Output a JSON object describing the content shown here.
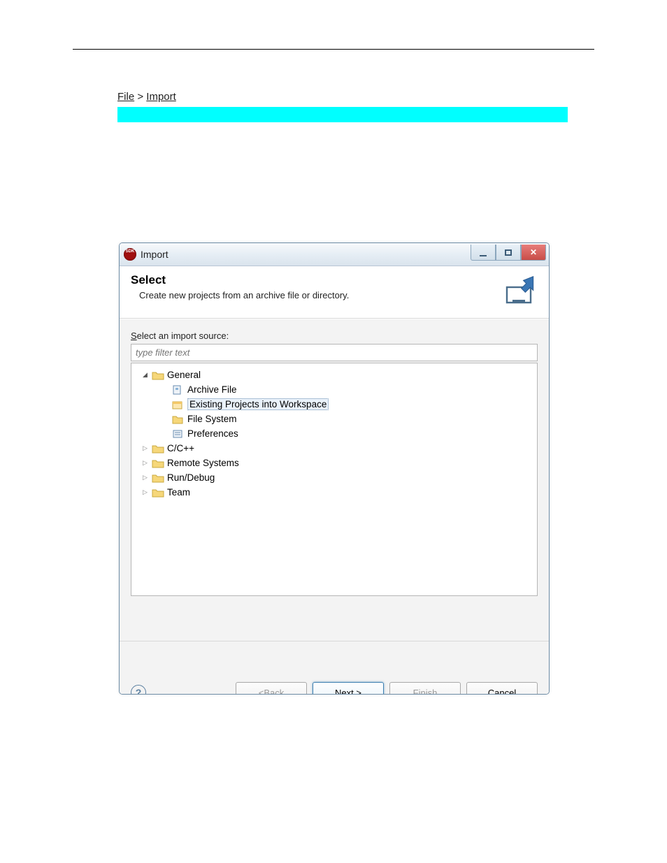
{
  "page": {
    "instr_prefix": "File",
    "instr_arrow": " > ",
    "instr_import": "Import"
  },
  "dialog": {
    "title": "Import",
    "header_title": "Select",
    "header_desc": "Create new projects from an archive file or directory.",
    "body_label_pre": "S",
    "body_label_post": "elect an import source:",
    "filter_placeholder": "type filter text",
    "tree": {
      "general": "General",
      "archive": "Archive File",
      "existing": "Existing Projects into Workspace",
      "filesystem": "File System",
      "preferences": "Preferences",
      "cpp": "C/C++",
      "remote": "Remote Systems",
      "rundebug": "Run/Debug",
      "team": "Team"
    },
    "buttons": {
      "back_pre": "< ",
      "back_ul": "B",
      "back_post": "ack",
      "next_pre": "N",
      "next_ul": "e",
      "next_post": "xt >",
      "finish_ul": "F",
      "finish_post": "inish",
      "cancel": "Cancel"
    }
  }
}
